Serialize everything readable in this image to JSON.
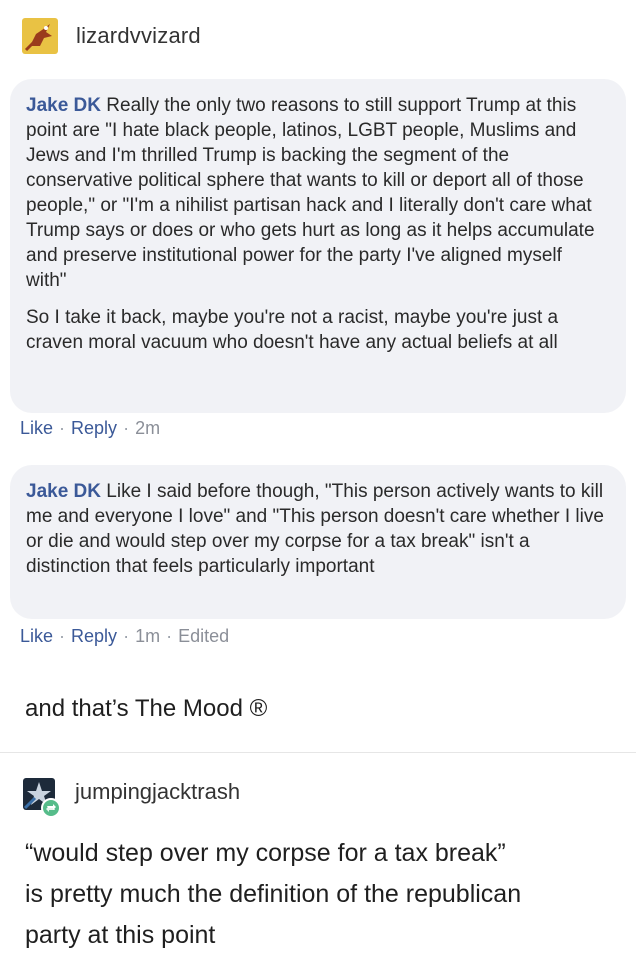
{
  "original_post": {
    "username": "lizardvvizard"
  },
  "comments": [
    {
      "author": "Jake DK",
      "paragraphs": [
        "Really the only two reasons to still support Trump at this point are \"I hate black people, latinos, LGBT people, Muslims and Jews and I'm thrilled Trump is backing the segment of the conservative political sphere that wants to kill or deport all of those people,\" or \"I'm a nihilist partisan hack and I literally don't care what Trump says or does or who gets hurt as long as it helps accumulate and preserve institutional power for the party I've aligned myself with\"",
        "So I take it back, maybe you're not a racist, maybe you're just a craven moral vacuum who doesn't have any actual beliefs at all"
      ],
      "actions": {
        "like": "Like",
        "reply": "Reply",
        "time": "2m"
      }
    },
    {
      "author": "Jake DK",
      "paragraphs": [
        "Like I said before though, \"This person actively wants to kill me and everyone I love\" and \"This person doesn't care whether I live or die and would step over my corpse for a tax break\" isn't a distinction that feels particularly important"
      ],
      "actions": {
        "like": "Like",
        "reply": "Reply",
        "time": "1m",
        "edited": "Edited"
      }
    }
  ],
  "caption": "and that’s The Mood ®",
  "reblog": {
    "username": "jumpingjacktrash",
    "text_lines": [
      "“would step over my corpse for a tax break”",
      "is pretty much the definition of the republican",
      "party at this point"
    ]
  },
  "colors": {
    "link_blue": "#3b5998",
    "bubble_bg": "#f1f2f6",
    "meta_gray": "#8b8f98",
    "reblog_green": "#56bc8a"
  },
  "icons": {
    "post_avatar": "lizard-avatar-icon",
    "reblog_avatar": "star-avatar-icon",
    "reblog_badge": "reblog-icon"
  }
}
